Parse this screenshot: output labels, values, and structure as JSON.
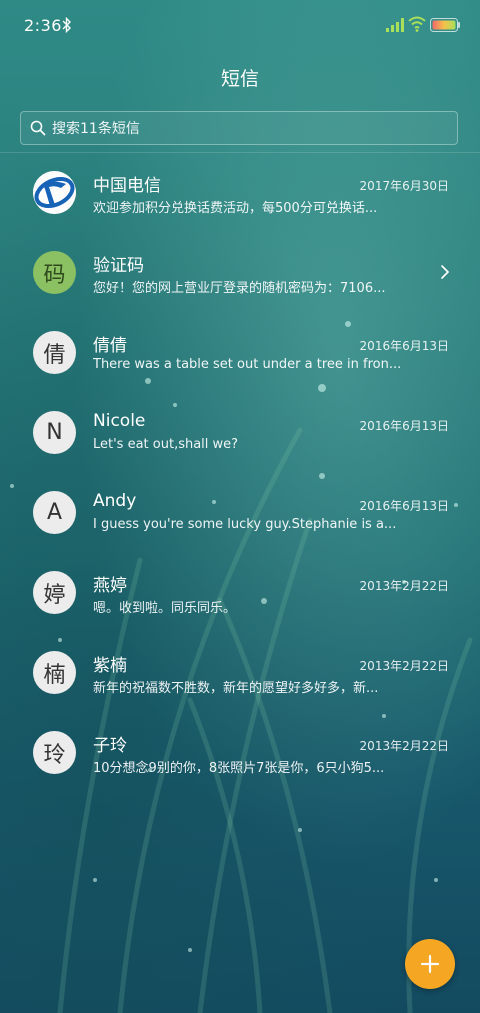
{
  "status_bar": {
    "time": "2:36",
    "icons": [
      "bluetooth-icon",
      "signal-icon",
      "wifi-icon",
      "battery-icon"
    ]
  },
  "header": {
    "title": "短信"
  },
  "search": {
    "placeholder": "搜索11条短信"
  },
  "conversations": [
    {
      "name": "中国电信",
      "date": "2017年6月30日",
      "preview": "欢迎参加积分兑换话费活动，每500分可兑换话...",
      "avatar": "china-telecom-logo"
    },
    {
      "name": "验证码",
      "date": "",
      "preview": "您好！您的网上营业厅登录的随机密码为：7106...",
      "avatar": "码",
      "avatar_color": "#8bc063"
    },
    {
      "name": "倩倩",
      "date": "2016年6月13日",
      "preview": "There was a table set out under a tree in fron...",
      "avatar": "倩"
    },
    {
      "name": "Nicole",
      "date": "2016年6月13日",
      "preview": "Let's eat out,shall we?",
      "avatar": "N"
    },
    {
      "name": "Andy",
      "date": "2016年6月13日",
      "preview": "I guess you're some lucky guy.Stephanie is a...",
      "avatar": "A"
    },
    {
      "name": "燕婷",
      "date": "2013年2月22日",
      "preview": "嗯。收到啦。同乐同乐。",
      "avatar": "婷"
    },
    {
      "name": "紫楠",
      "date": "2013年2月22日",
      "preview": "新年的祝福数不胜数，新年的愿望好多好多，新...",
      "avatar": "楠"
    },
    {
      "name": "子玲",
      "date": "2013年2月22日",
      "preview": "10分想念9别的你，8张照片7张是你，6只小狗5...",
      "avatar": "玲"
    }
  ],
  "fab": {
    "icon": "plus-icon",
    "color": "#f5a623"
  }
}
